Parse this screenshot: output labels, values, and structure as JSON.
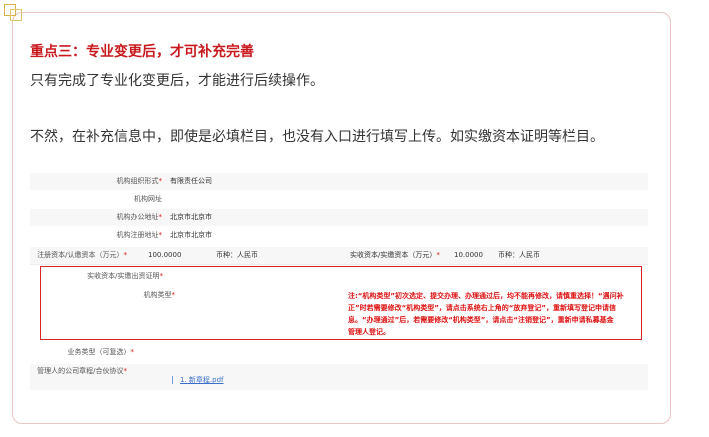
{
  "article": {
    "heading": "重点三：专业变更后，才可补充完善",
    "para1": "只有完成了专业化变更后，才能进行后续操作。",
    "para2": "不然，在补充信息中，即使是必填栏目，也没有入口进行填写上传。如实缴资本证明等栏目。"
  },
  "form": {
    "rows": {
      "org_form": {
        "label": "机构组织形式",
        "req": "*",
        "value": "有限责任公司"
      },
      "website": {
        "label": "机构网址",
        "req": "",
        "value": ""
      },
      "office_addr": {
        "label": "机构办公地址",
        "req": "*",
        "value": "北京市北京市"
      },
      "reg_addr": {
        "label": "机构注册地址",
        "req": "*",
        "value": "北京市北京市"
      },
      "capital": {
        "label": "注册资本/认缴资本（万元）",
        "req": "*",
        "value": "100.0000",
        "currency_label": "币种：",
        "currency": "人民币",
        "paid_label": "实收资本/实缴资本（万元）",
        "paid_req": "*",
        "paid_value": "10.0000",
        "paid_currency_label": "币种：",
        "paid_currency": "人民币"
      },
      "paid_proof": {
        "label": "实收资本/实缴出资证明",
        "req": "*"
      },
      "org_type": {
        "label": "机构类型",
        "req": "*",
        "note_lines": [
          "注:“机构类型”初次选定、提交办理、办理通过后，均不能再修改，请慎重选择！“遇问补",
          "正”时若需要修改“机构类型”，请点击系统右上角的“放弃登记”，重新填写登记申请信",
          "息。“办理通过”后，若需要修改“机构类型”，请点击“注销登记”，重新申请私募基金",
          "管理人登记。"
        ]
      },
      "business_type": {
        "label": "业务类型（可复选）",
        "req": "*"
      },
      "articles": {
        "label": "管理人的公司章程/合伙协议",
        "req": "*",
        "file": "1. 新章程.pdf"
      }
    }
  }
}
